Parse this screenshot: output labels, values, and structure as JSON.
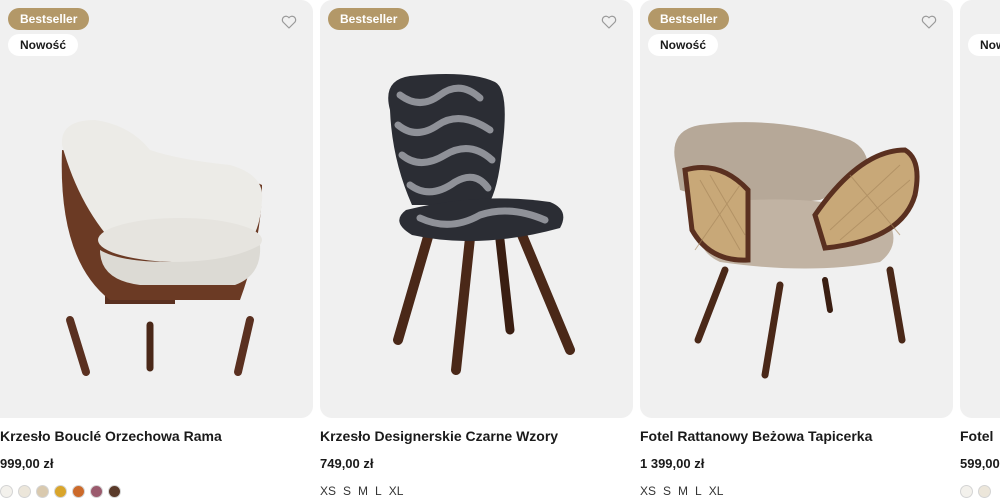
{
  "products": [
    {
      "badges": {
        "bestseller": "Bestseller",
        "new": "Nowość"
      },
      "title": "Krzesło Bouclé Orzechowa Rama",
      "price": "999,00 zł",
      "swatches": [
        "#f3f1ec",
        "#ece6da",
        "#d9c9ae",
        "#d9a52b",
        "#cc6a2a",
        "#9a5a6d",
        "#5a3a2a"
      ]
    },
    {
      "badges": {
        "bestseller": "Bestseller"
      },
      "title": "Krzesło Designerskie Czarne Wzory",
      "price": "749,00 zł",
      "sizes": [
        "XS",
        "S",
        "M",
        "L",
        "XL"
      ]
    },
    {
      "badges": {
        "bestseller": "Bestseller",
        "new": "Nowość"
      },
      "title": "Fotel Rattanowy Beżowa Tapicerka",
      "price": "1 399,00 zł",
      "sizes": [
        "XS",
        "S",
        "M",
        "L",
        "XL"
      ]
    },
    {
      "badges": {
        "new": "Nowość"
      },
      "title": "Fotel",
      "price": "599,00",
      "swatches": [
        "#f3f1ec",
        "#ece6da"
      ]
    }
  ],
  "colors": {
    "accent": "#b39868",
    "card_bg": "#f0f0f0",
    "text": "#1a1a1a"
  },
  "icons": {
    "favorite": "heart-outline-icon"
  }
}
